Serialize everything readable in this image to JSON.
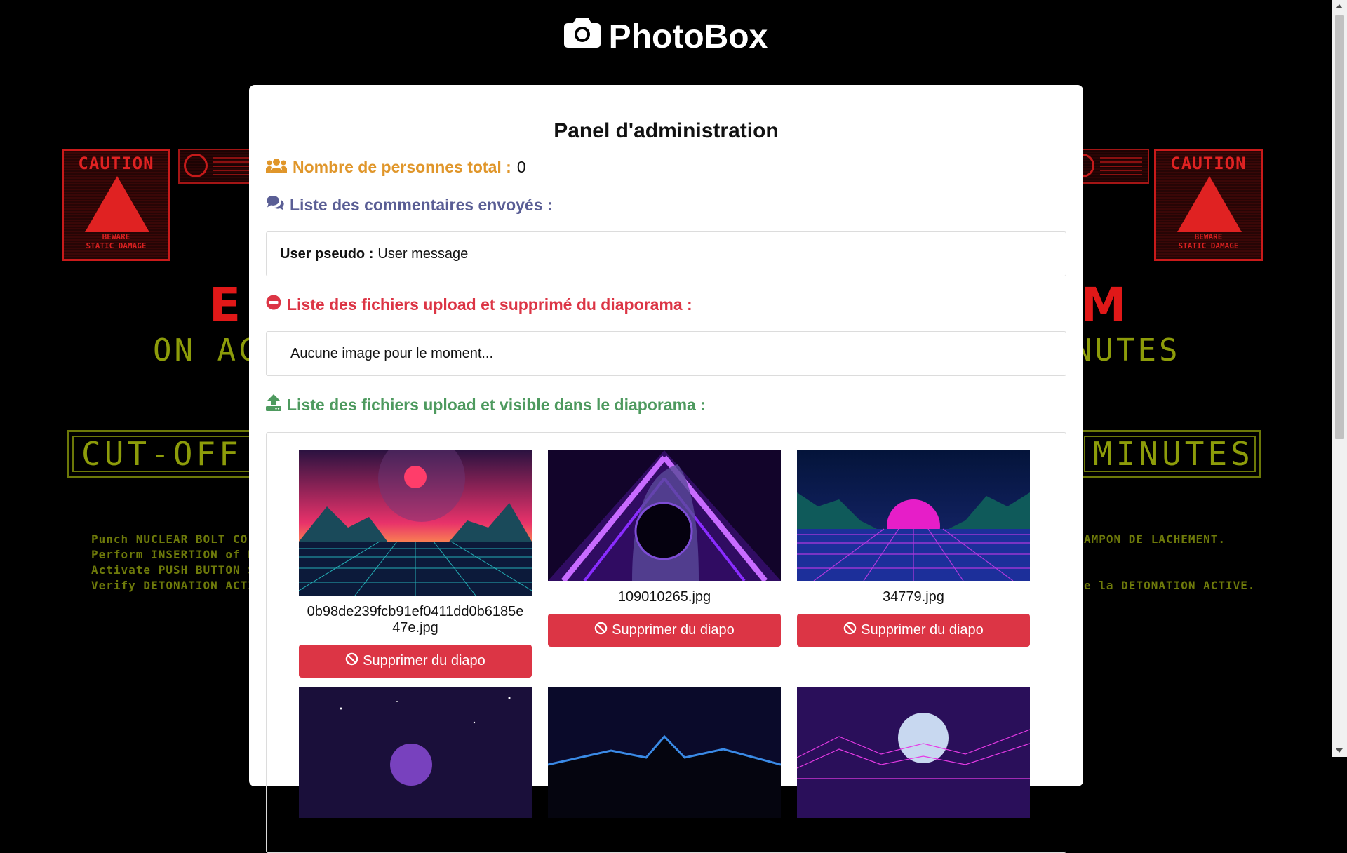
{
  "app": {
    "title": "PhotoBox",
    "logo_icon": "camera-icon"
  },
  "background_poster": {
    "caution_label": "CAUTION",
    "beware_label": "BEWARE",
    "static_damage_label": "STATIC      DAMAGE",
    "big_left": "E",
    "big_right": "M",
    "mid_left": "ON AC",
    "mid_right": "NUTES",
    "box_left": "CUT-OFF S",
    "box_right": "MINUTES",
    "small_left": "Punch NUCLEAR BOLT CO\nPerform INSERTION of BO\nActivate PUSH BUTTON S\nVerify DETONATION ACTIV",
    "small_right": "AMPON DE LACHEMENT.\n\n\ne la DETONATION ACTIVE."
  },
  "panel": {
    "title": "Panel d'administration",
    "people_count": {
      "icon": "users-icon",
      "label": "Nombre de personnes total :",
      "value": "0"
    },
    "comments": {
      "icon": "comments-icon",
      "heading": "Liste des commentaires envoyés :",
      "items": [
        {
          "pseudo": "User pseudo :",
          "message": "User message"
        }
      ]
    },
    "removed_files": {
      "icon": "minus-circle-icon",
      "heading": "Liste des fichiers upload et supprimé du diaporama :",
      "empty_text": "Aucune image pour le moment..."
    },
    "visible_files": {
      "icon": "upload-icon",
      "heading": "Liste des fichiers upload et visible dans le diaporama :",
      "delete_label": "Supprimer du diapo",
      "items": [
        {
          "filename": "0b98de239fcb91ef0411dd0b6185e47e.jpg"
        },
        {
          "filename": "109010265.jpg"
        },
        {
          "filename": "34779.jpg"
        },
        {
          "filename": ""
        },
        {
          "filename": ""
        },
        {
          "filename": ""
        }
      ]
    }
  },
  "colors": {
    "count_heading": "#e0962a",
    "comments_heading": "#5a5e95",
    "removed_heading": "#dc3545",
    "visible_heading": "#4e9a5f",
    "delete_button": "#dc3545"
  }
}
